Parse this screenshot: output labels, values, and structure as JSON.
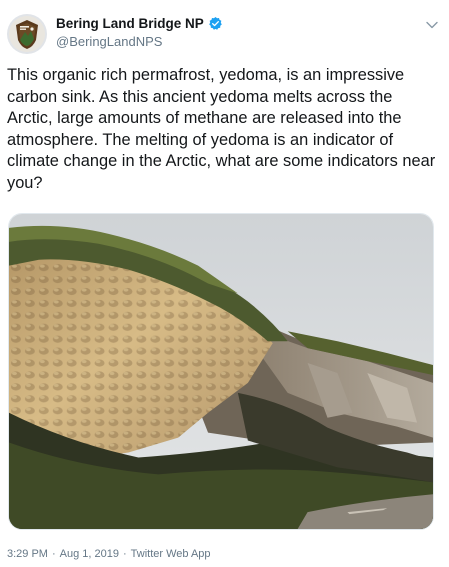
{
  "account": {
    "display_name": "Bering Land Bridge NP",
    "handle": "@BeringLandNPS",
    "verified": true,
    "avatar_icon": "nps-arrowhead-icon",
    "verified_icon": "verified-badge-icon",
    "verified_color": "#1da1f2"
  },
  "menu": {
    "icon": "chevron-down-icon"
  },
  "tweet": {
    "text": "This organic rich permafrost, yedoma, is an impressive carbon sink. As this ancient yedoma melts across the Arctic, large amounts of methane are released into the atmosphere. The melting of yedoma is an indicator of climate change in the Arctic, what are some indicators near you?"
  },
  "media": {
    "image_icon": "photo-eroding-yedoma-bluff"
  },
  "meta": {
    "time": "3:29 PM",
    "separator1": "·",
    "date": "Aug 1, 2019",
    "separator2": "·",
    "source": "Twitter Web App"
  },
  "colors": {
    "text": "#14171a",
    "secondary": "#657786",
    "accent": "#1da1f2"
  }
}
